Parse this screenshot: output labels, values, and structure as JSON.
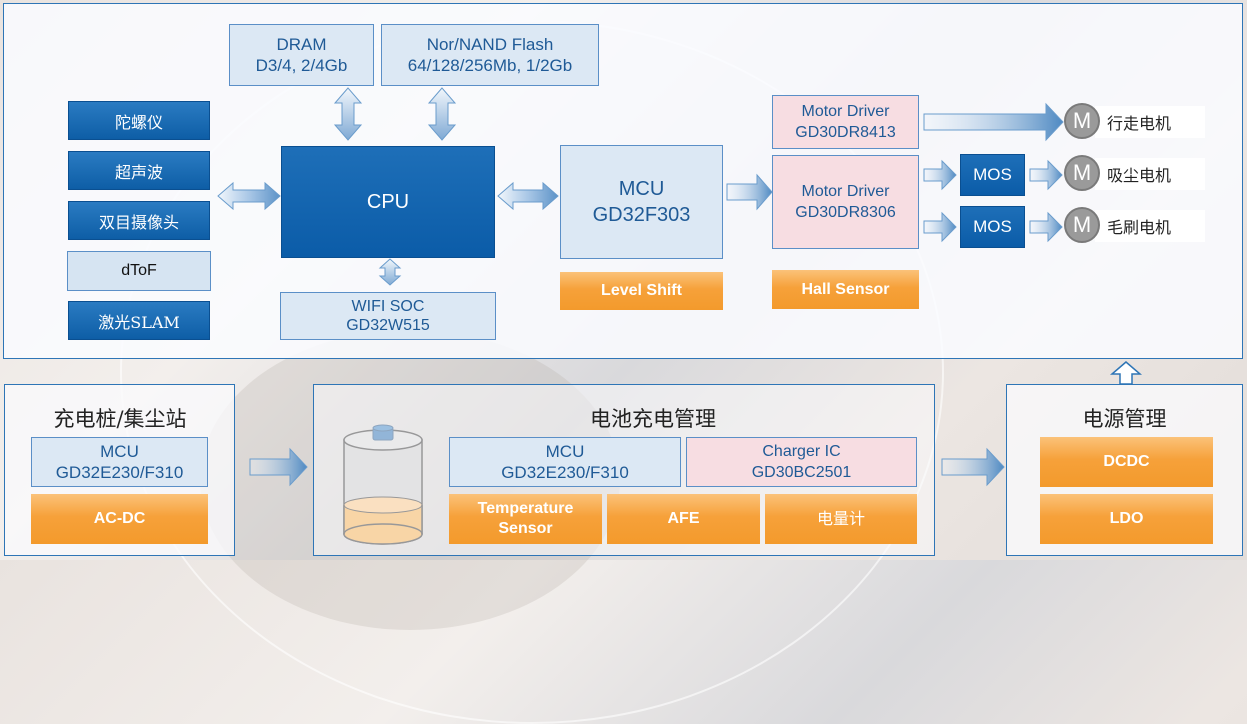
{
  "main_system": {
    "memory": [
      {
        "name": "DRAM",
        "spec": "D3/4, 2/4Gb"
      },
      {
        "name": "Nor/NAND Flash",
        "spec": "64/128/256Mb, 1/2Gb"
      }
    ],
    "sensors": [
      "陀螺仪",
      "超声波",
      "双目摄像头",
      "dToF",
      "激光SLAM"
    ],
    "cpu": {
      "label": "CPU"
    },
    "wifi": {
      "name": "WIFI SOC",
      "part": "GD32W515"
    },
    "mcu": {
      "name": "MCU",
      "part": "GD32F303"
    },
    "level_shift": "Level Shift",
    "motor_drivers": [
      {
        "name": "Motor Driver",
        "part": "GD30DR8413"
      },
      {
        "name": "Motor Driver",
        "part": "GD30DR8306"
      }
    ],
    "hall_sensor": "Hall Sensor",
    "mos": [
      "MOS",
      "MOS"
    ],
    "motors": [
      {
        "symbol": "M",
        "label": "行走电机"
      },
      {
        "symbol": "M",
        "label": "吸尘电机"
      },
      {
        "symbol": "M",
        "label": "毛刷电机"
      }
    ]
  },
  "charging_station": {
    "title": "充电桩/集尘站",
    "mcu": {
      "name": "MCU",
      "part": "GD32E230/F310"
    },
    "acdc": "AC-DC"
  },
  "battery_management": {
    "title": "电池充电管理",
    "mcu": {
      "name": "MCU",
      "part": "GD32E230/F310"
    },
    "charger": {
      "name": "Charger IC",
      "part": "GD30BC2501"
    },
    "temperature_sensor": {
      "line1": "Temperature",
      "line2": "Sensor"
    },
    "afe": "AFE",
    "fuel_gauge": "电量计"
  },
  "power_management": {
    "title": "电源管理",
    "dcdc": "DCDC",
    "ldo": "LDO"
  },
  "colors": {
    "border_blue": "#2e75b6",
    "dark_blue": "#0b5ca8",
    "light_blue": "#dce8f4",
    "pink": "#f7dde2",
    "orange": "#f39a2c"
  }
}
